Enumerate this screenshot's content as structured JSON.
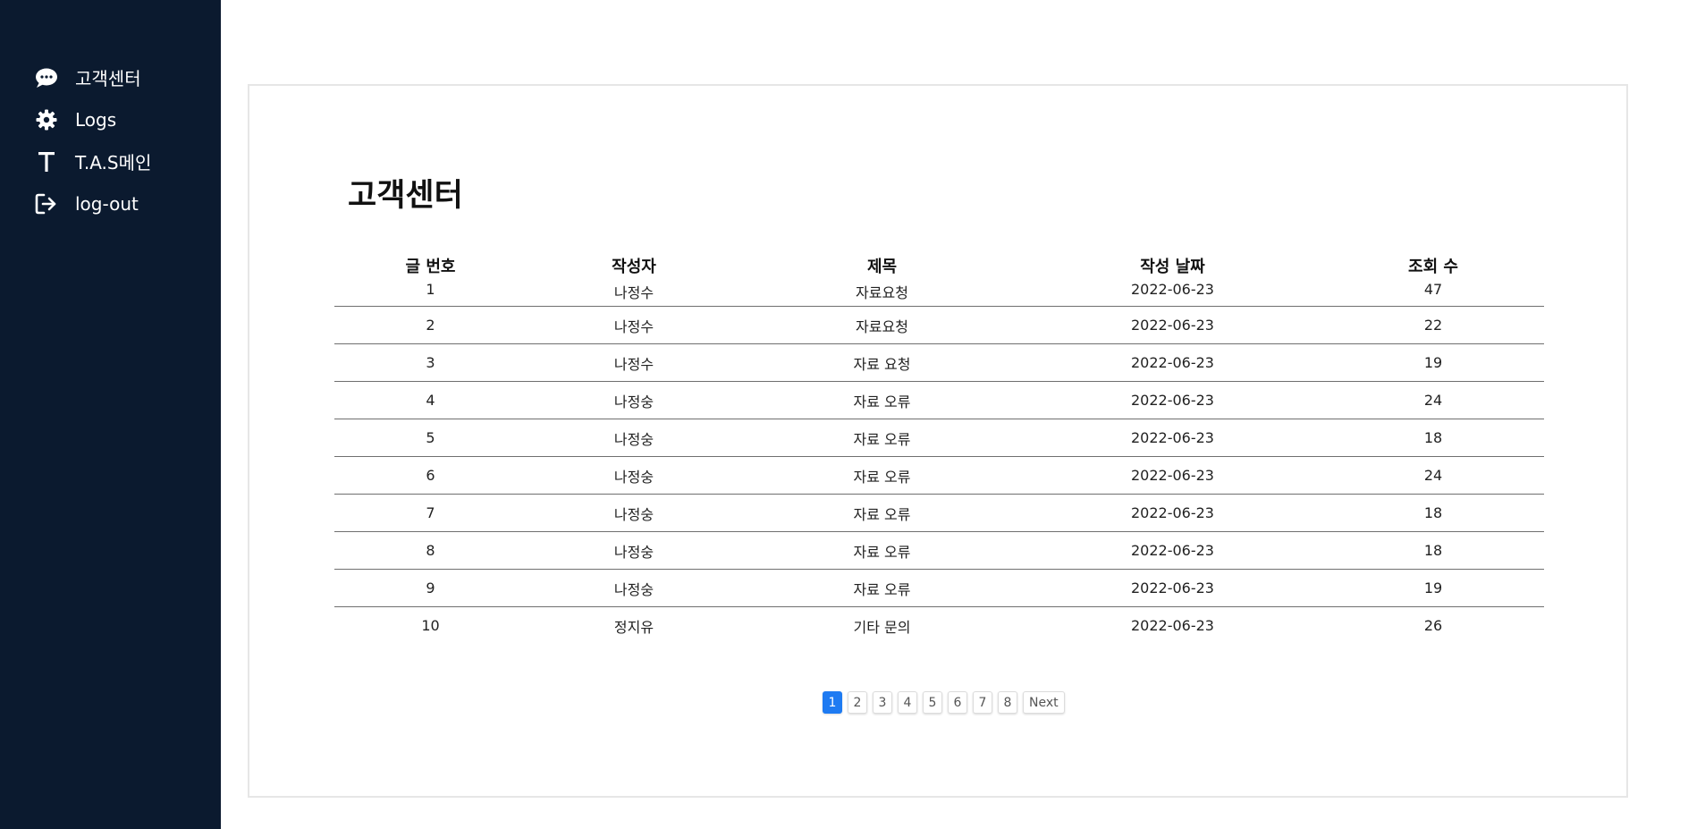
{
  "sidebar": {
    "background": "#0b1a2f",
    "items": [
      {
        "icon": "chat-bubble-icon",
        "label": "고객센터"
      },
      {
        "icon": "gear-icon",
        "label": "Logs"
      },
      {
        "icon": "letter-t-icon",
        "label": "T.A.S메인"
      },
      {
        "icon": "sign-out-icon",
        "label": "log-out"
      }
    ]
  },
  "main": {
    "title": "고객센터",
    "table": {
      "headers": [
        "글 번호",
        "작성자",
        "제목",
        "작성 날짜",
        "조회 수"
      ],
      "rows": [
        [
          "1",
          "나정수",
          "자료요청",
          "2022-06-23",
          "47"
        ],
        [
          "2",
          "나정수",
          "자료요청",
          "2022-06-23",
          "22"
        ],
        [
          "3",
          "나정수",
          "자료 요청",
          "2022-06-23",
          "19"
        ],
        [
          "4",
          "나정숭",
          "자료 오류",
          "2022-06-23",
          "24"
        ],
        [
          "5",
          "나정숭",
          "자료 오류",
          "2022-06-23",
          "18"
        ],
        [
          "6",
          "나정숭",
          "자료 오류",
          "2022-06-23",
          "24"
        ],
        [
          "7",
          "나정숭",
          "자료 오류",
          "2022-06-23",
          "18"
        ],
        [
          "8",
          "나정숭",
          "자료 오류",
          "2022-06-23",
          "18"
        ],
        [
          "9",
          "나정숭",
          "자료 오류",
          "2022-06-23",
          "19"
        ],
        [
          "10",
          "정지유",
          "기타 문의",
          "2022-06-23",
          "26"
        ]
      ]
    },
    "pagination": {
      "pages": [
        "1",
        "2",
        "3",
        "4",
        "5",
        "6",
        "7",
        "8"
      ],
      "active": "1",
      "next_label": "Next",
      "accent": "#1e7bf2"
    }
  }
}
